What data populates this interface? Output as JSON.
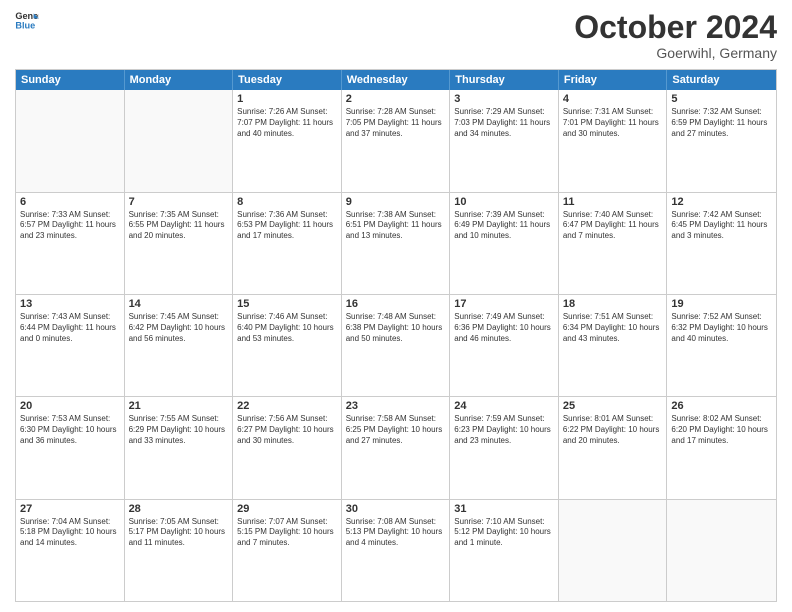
{
  "header": {
    "logo_line1": "General",
    "logo_line2": "Blue",
    "month": "October 2024",
    "location": "Goerwihl, Germany"
  },
  "days_of_week": [
    "Sunday",
    "Monday",
    "Tuesday",
    "Wednesday",
    "Thursday",
    "Friday",
    "Saturday"
  ],
  "weeks": [
    [
      {
        "day": "",
        "info": ""
      },
      {
        "day": "",
        "info": ""
      },
      {
        "day": "1",
        "info": "Sunrise: 7:26 AM\nSunset: 7:07 PM\nDaylight: 11 hours\nand 40 minutes."
      },
      {
        "day": "2",
        "info": "Sunrise: 7:28 AM\nSunset: 7:05 PM\nDaylight: 11 hours\nand 37 minutes."
      },
      {
        "day": "3",
        "info": "Sunrise: 7:29 AM\nSunset: 7:03 PM\nDaylight: 11 hours\nand 34 minutes."
      },
      {
        "day": "4",
        "info": "Sunrise: 7:31 AM\nSunset: 7:01 PM\nDaylight: 11 hours\nand 30 minutes."
      },
      {
        "day": "5",
        "info": "Sunrise: 7:32 AM\nSunset: 6:59 PM\nDaylight: 11 hours\nand 27 minutes."
      }
    ],
    [
      {
        "day": "6",
        "info": "Sunrise: 7:33 AM\nSunset: 6:57 PM\nDaylight: 11 hours\nand 23 minutes."
      },
      {
        "day": "7",
        "info": "Sunrise: 7:35 AM\nSunset: 6:55 PM\nDaylight: 11 hours\nand 20 minutes."
      },
      {
        "day": "8",
        "info": "Sunrise: 7:36 AM\nSunset: 6:53 PM\nDaylight: 11 hours\nand 17 minutes."
      },
      {
        "day": "9",
        "info": "Sunrise: 7:38 AM\nSunset: 6:51 PM\nDaylight: 11 hours\nand 13 minutes."
      },
      {
        "day": "10",
        "info": "Sunrise: 7:39 AM\nSunset: 6:49 PM\nDaylight: 11 hours\nand 10 minutes."
      },
      {
        "day": "11",
        "info": "Sunrise: 7:40 AM\nSunset: 6:47 PM\nDaylight: 11 hours\nand 7 minutes."
      },
      {
        "day": "12",
        "info": "Sunrise: 7:42 AM\nSunset: 6:45 PM\nDaylight: 11 hours\nand 3 minutes."
      }
    ],
    [
      {
        "day": "13",
        "info": "Sunrise: 7:43 AM\nSunset: 6:44 PM\nDaylight: 11 hours\nand 0 minutes."
      },
      {
        "day": "14",
        "info": "Sunrise: 7:45 AM\nSunset: 6:42 PM\nDaylight: 10 hours\nand 56 minutes."
      },
      {
        "day": "15",
        "info": "Sunrise: 7:46 AM\nSunset: 6:40 PM\nDaylight: 10 hours\nand 53 minutes."
      },
      {
        "day": "16",
        "info": "Sunrise: 7:48 AM\nSunset: 6:38 PM\nDaylight: 10 hours\nand 50 minutes."
      },
      {
        "day": "17",
        "info": "Sunrise: 7:49 AM\nSunset: 6:36 PM\nDaylight: 10 hours\nand 46 minutes."
      },
      {
        "day": "18",
        "info": "Sunrise: 7:51 AM\nSunset: 6:34 PM\nDaylight: 10 hours\nand 43 minutes."
      },
      {
        "day": "19",
        "info": "Sunrise: 7:52 AM\nSunset: 6:32 PM\nDaylight: 10 hours\nand 40 minutes."
      }
    ],
    [
      {
        "day": "20",
        "info": "Sunrise: 7:53 AM\nSunset: 6:30 PM\nDaylight: 10 hours\nand 36 minutes."
      },
      {
        "day": "21",
        "info": "Sunrise: 7:55 AM\nSunset: 6:29 PM\nDaylight: 10 hours\nand 33 minutes."
      },
      {
        "day": "22",
        "info": "Sunrise: 7:56 AM\nSunset: 6:27 PM\nDaylight: 10 hours\nand 30 minutes."
      },
      {
        "day": "23",
        "info": "Sunrise: 7:58 AM\nSunset: 6:25 PM\nDaylight: 10 hours\nand 27 minutes."
      },
      {
        "day": "24",
        "info": "Sunrise: 7:59 AM\nSunset: 6:23 PM\nDaylight: 10 hours\nand 23 minutes."
      },
      {
        "day": "25",
        "info": "Sunrise: 8:01 AM\nSunset: 6:22 PM\nDaylight: 10 hours\nand 20 minutes."
      },
      {
        "day": "26",
        "info": "Sunrise: 8:02 AM\nSunset: 6:20 PM\nDaylight: 10 hours\nand 17 minutes."
      }
    ],
    [
      {
        "day": "27",
        "info": "Sunrise: 7:04 AM\nSunset: 5:18 PM\nDaylight: 10 hours\nand 14 minutes."
      },
      {
        "day": "28",
        "info": "Sunrise: 7:05 AM\nSunset: 5:17 PM\nDaylight: 10 hours\nand 11 minutes."
      },
      {
        "day": "29",
        "info": "Sunrise: 7:07 AM\nSunset: 5:15 PM\nDaylight: 10 hours\nand 7 minutes."
      },
      {
        "day": "30",
        "info": "Sunrise: 7:08 AM\nSunset: 5:13 PM\nDaylight: 10 hours\nand 4 minutes."
      },
      {
        "day": "31",
        "info": "Sunrise: 7:10 AM\nSunset: 5:12 PM\nDaylight: 10 hours\nand 1 minute."
      },
      {
        "day": "",
        "info": ""
      },
      {
        "day": "",
        "info": ""
      }
    ]
  ]
}
